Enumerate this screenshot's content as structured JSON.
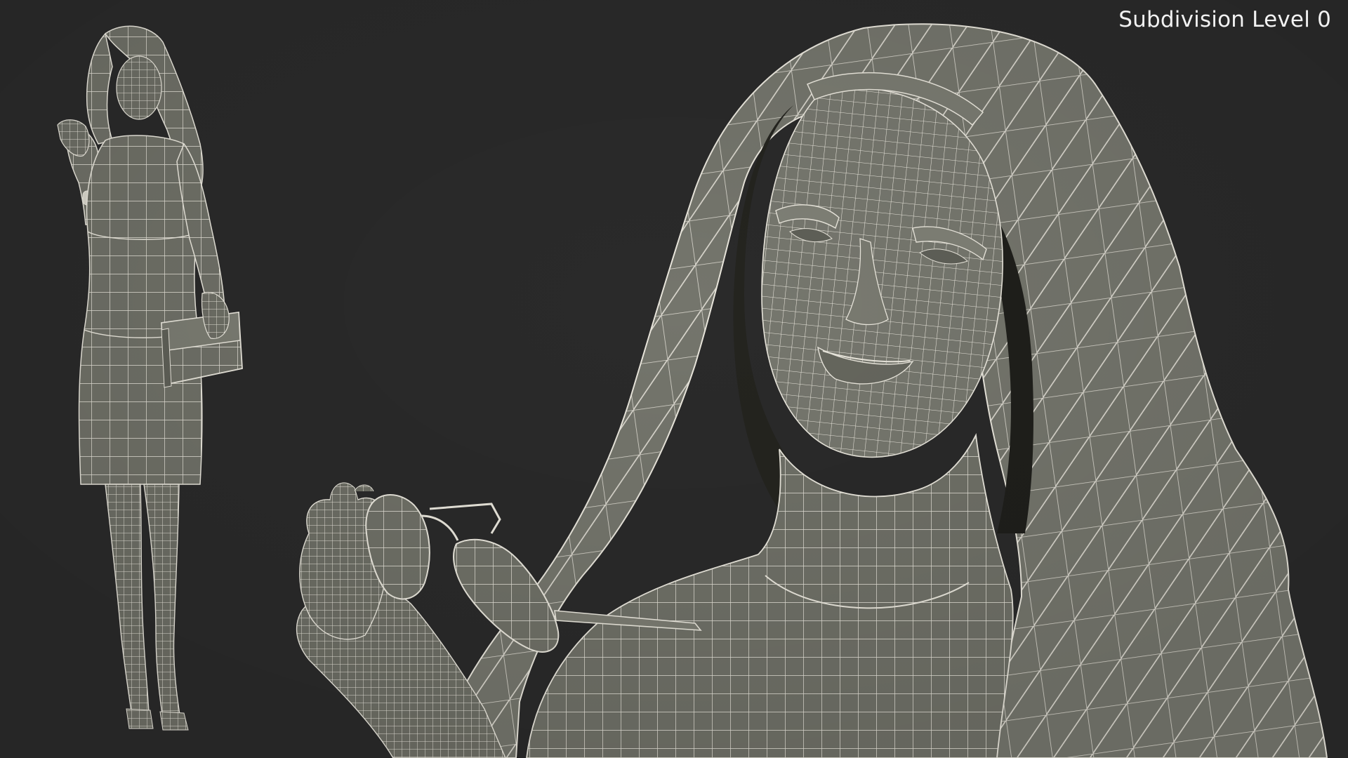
{
  "caption": "Subdivision Level 0",
  "colors": {
    "background": "#2a2a2a",
    "mesh_fill": "#6f7067",
    "mesh_fill_dark": "#5a5b53",
    "mesh_fill_light": "#7d7e74",
    "wireframe": "#e9e6dc",
    "shadow": "#1c1c1c"
  }
}
